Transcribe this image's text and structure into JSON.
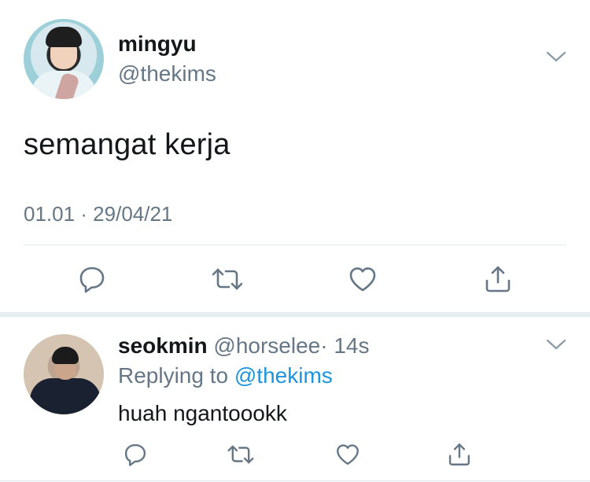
{
  "main_tweet": {
    "name": "mingyu",
    "handle": "@thekims",
    "text": "semangat kerja",
    "meta": "01.01 · 29/04/21"
  },
  "reply_tweet": {
    "name": "seokmin",
    "handle": "@horselee",
    "time": "· 14s",
    "replying_label": "Replying to",
    "replying_to": "@thekims",
    "text": "huah ngantoookk"
  },
  "icons": {
    "reply": "reply-icon",
    "retweet": "retweet-icon",
    "like": "like-icon",
    "share": "share-icon",
    "more": "chevron-down-icon"
  },
  "colors": {
    "text": "#14171a",
    "secondary": "#657786",
    "link": "#1b95e0",
    "divider": "#e1e8ed"
  }
}
